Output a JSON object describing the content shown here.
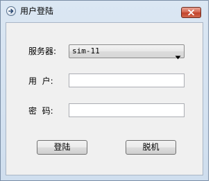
{
  "window": {
    "title": "用户登陆"
  },
  "form": {
    "server_label": "服务器:",
    "server_value": "sim-11",
    "user_label": "用  户:",
    "user_value": "",
    "password_label": "密  码:",
    "password_value": ""
  },
  "buttons": {
    "login_label": "登陆",
    "offline_label": "脱机"
  },
  "icons": {
    "title_icon": "arrow-right-circle-icon",
    "close_icon": "close-x-icon",
    "combo_arrow": "chevron-down-icon"
  },
  "colors": {
    "close_button": "#c7472e",
    "frame": "#cfdeee"
  }
}
